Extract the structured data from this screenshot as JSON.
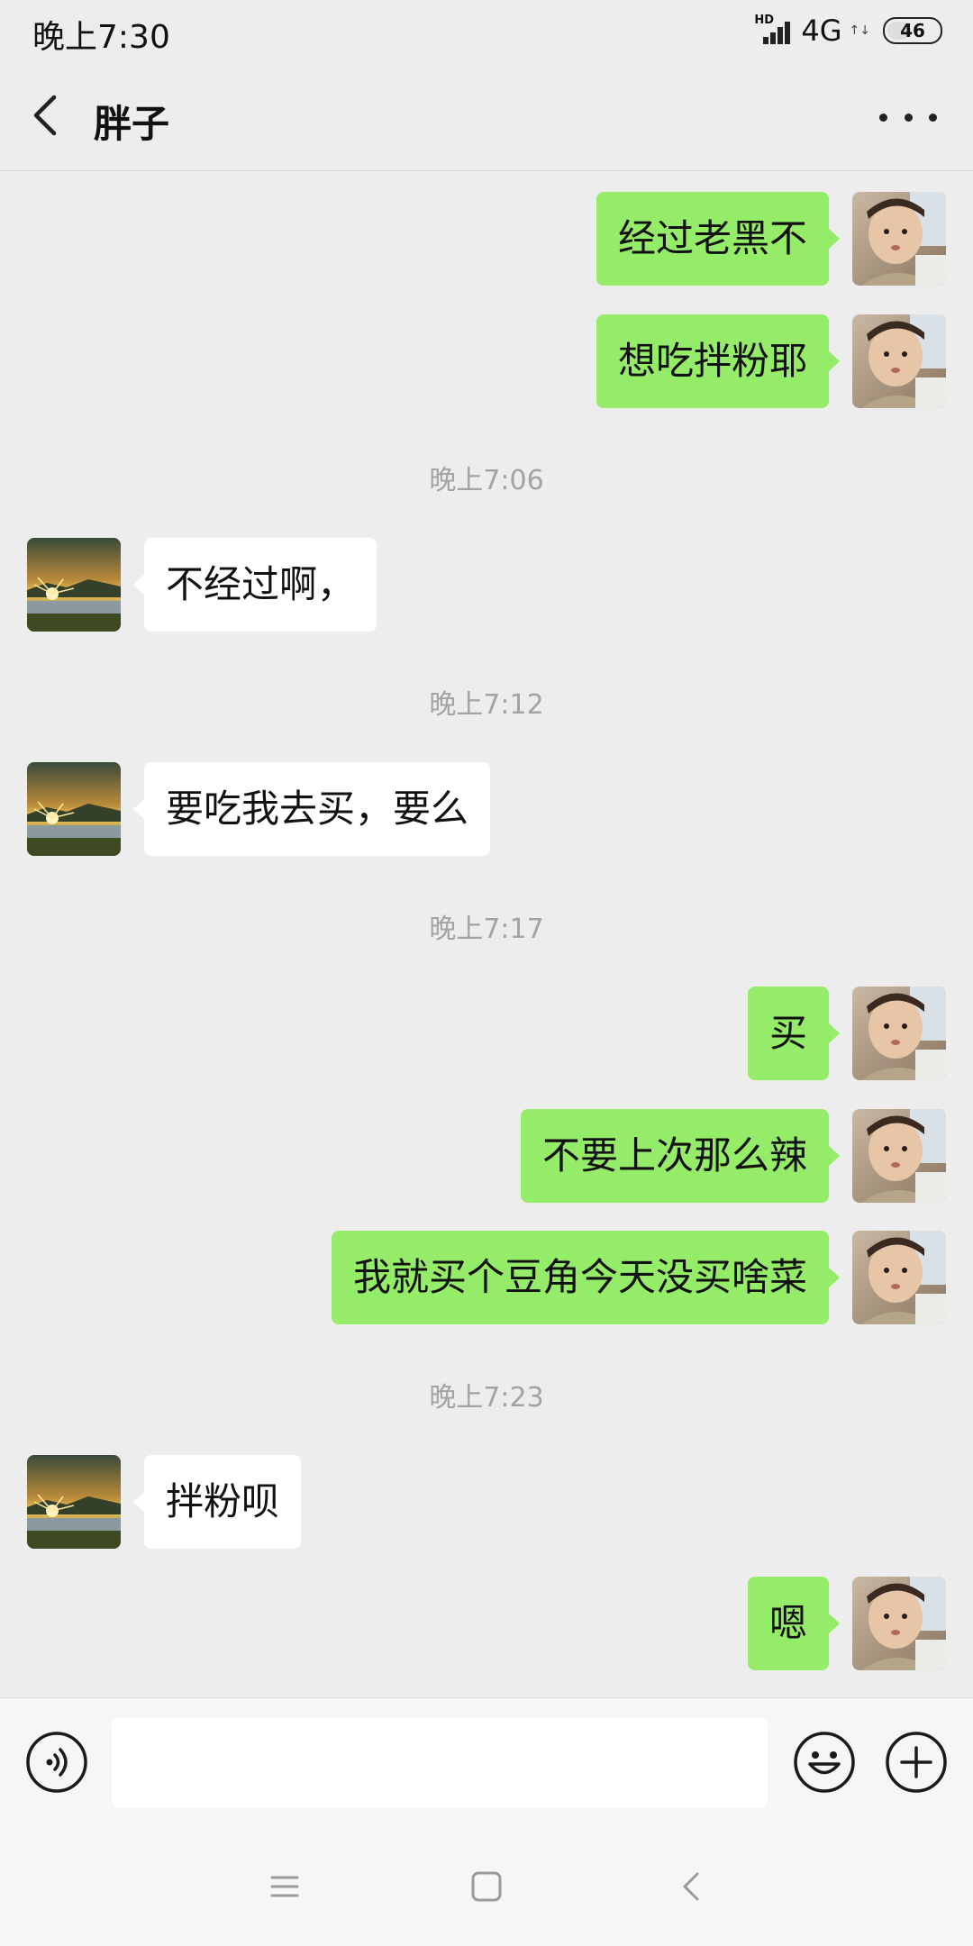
{
  "status_bar": {
    "time": "晚上7:30",
    "hd": "HD",
    "network": "4G",
    "network_arrows": "↑↓",
    "battery": "46"
  },
  "header": {
    "title": "胖子",
    "back_icon": "chevron-left-icon",
    "more_icon": "more-dots-icon"
  },
  "timestamps": [
    "晚上7:06",
    "晚上7:12",
    "晚上7:17",
    "晚上7:23"
  ],
  "messages": [
    {
      "side": "right",
      "text": "经过老黑不"
    },
    {
      "side": "right",
      "text": "想吃拌粉耶"
    },
    {
      "side": "left",
      "text": "不经过啊，"
    },
    {
      "side": "left",
      "text": "要吃我去买，要么"
    },
    {
      "side": "right",
      "text": "买"
    },
    {
      "side": "right",
      "text": "不要上次那么辣"
    },
    {
      "side": "right",
      "text": "我就买个豆角今天没买啥菜"
    },
    {
      "side": "left",
      "text": "拌粉呗"
    },
    {
      "side": "right",
      "text": "嗯"
    }
  ],
  "input_bar": {
    "placeholder": "",
    "voice_icon": "voice-icon",
    "emoji_icon": "emoji-icon",
    "plus_icon": "plus-icon"
  },
  "nav_bar": {
    "icons": [
      "menu-icon",
      "home-icon",
      "back-icon"
    ]
  },
  "colors": {
    "sent_bubble": "#95ec69",
    "received_bubble": "#ffffff",
    "background": "#ededed"
  }
}
